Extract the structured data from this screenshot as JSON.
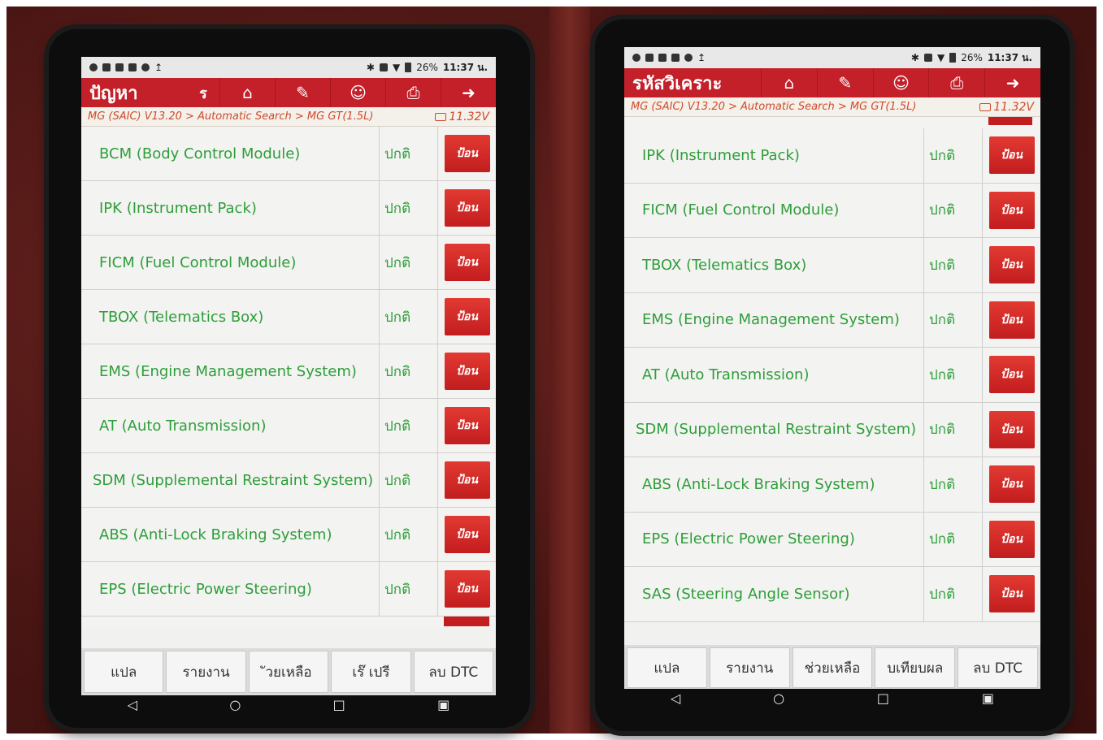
{
  "left": {
    "status": {
      "battery": "26%",
      "time": "11:37 น."
    },
    "toolbar": {
      "title": "ปัญหา",
      "extra": "ร"
    },
    "breadcrumb": {
      "path": "MG (SAIC) V13.20 > Automatic Search > MG GT(1.5L)",
      "voltage": "11.32V"
    },
    "rows": [
      {
        "name": "BCM (Body Control Module)",
        "status": "ปกติ",
        "action": "ป้อน"
      },
      {
        "name": "IPK (Instrument Pack)",
        "status": "ปกติ",
        "action": "ป้อน"
      },
      {
        "name": "FICM (Fuel Control Module)",
        "status": "ปกติ",
        "action": "ป้อน"
      },
      {
        "name": "TBOX (Telematics Box)",
        "status": "ปกติ",
        "action": "ป้อน"
      },
      {
        "name": "EMS (Engine Management System)",
        "status": "ปกติ",
        "action": "ป้อน"
      },
      {
        "name": "AT (Auto Transmission)",
        "status": "ปกติ",
        "action": "ป้อน"
      },
      {
        "name": "SDM (Supplemental Restraint System)",
        "status": "ปกติ",
        "action": "ป้อน"
      },
      {
        "name": "ABS (Anti-Lock Braking System)",
        "status": "ปกติ",
        "action": "ป้อน"
      },
      {
        "name": "EPS (Electric Power Steering)",
        "status": "ปกติ",
        "action": "ป้อน"
      }
    ],
    "bottom": [
      "แปล",
      "รายงาน",
      "ัวยเหลือ",
      "เร๊  เปรี",
      "ลบ DTC"
    ]
  },
  "right": {
    "status": {
      "battery": "26%",
      "time": "11:37 น."
    },
    "toolbar": {
      "title": "รหัสวิเคราะ"
    },
    "breadcrumb": {
      "path": "MG (SAIC) V13.20 > Automatic Search > MG GT(1.5L)",
      "voltage": "11.32V"
    },
    "rows": [
      {
        "name": "IPK (Instrument Pack)",
        "status": "ปกติ",
        "action": "ป้อน"
      },
      {
        "name": "FICM (Fuel Control Module)",
        "status": "ปกติ",
        "action": "ป้อน"
      },
      {
        "name": "TBOX (Telematics Box)",
        "status": "ปกติ",
        "action": "ป้อน"
      },
      {
        "name": "EMS (Engine Management System)",
        "status": "ปกติ",
        "action": "ป้อน"
      },
      {
        "name": "AT (Auto Transmission)",
        "status": "ปกติ",
        "action": "ป้อน"
      },
      {
        "name": "SDM (Supplemental Restraint System)",
        "status": "ปกติ",
        "action": "ป้อน"
      },
      {
        "name": "ABS (Anti-Lock Braking System)",
        "status": "ปกติ",
        "action": "ป้อน"
      },
      {
        "name": "EPS (Electric Power Steering)",
        "status": "ปกติ",
        "action": "ป้อน"
      },
      {
        "name": "SAS (Steering Angle Sensor)",
        "status": "ปกติ",
        "action": "ป้อน"
      }
    ],
    "bottom": [
      "แปล",
      "รายงาน",
      "ช่วยเหลือ",
      "บเทียบผล",
      "ลบ DTC"
    ]
  },
  "nav": {
    "back": "◁",
    "home": "○",
    "recent": "□",
    "screenshot": "▣"
  },
  "icons": {
    "toolbar": [
      "home-icon",
      "edit-icon",
      "user-icon",
      "print-icon",
      "exit-icon"
    ],
    "status": [
      "location-icon",
      "usb-icon",
      "image-icon",
      "drive-icon",
      "accessibility-icon",
      "upload-icon",
      "bluetooth-icon",
      "vibrate-icon",
      "wifi-icon",
      "battery-icon"
    ]
  }
}
